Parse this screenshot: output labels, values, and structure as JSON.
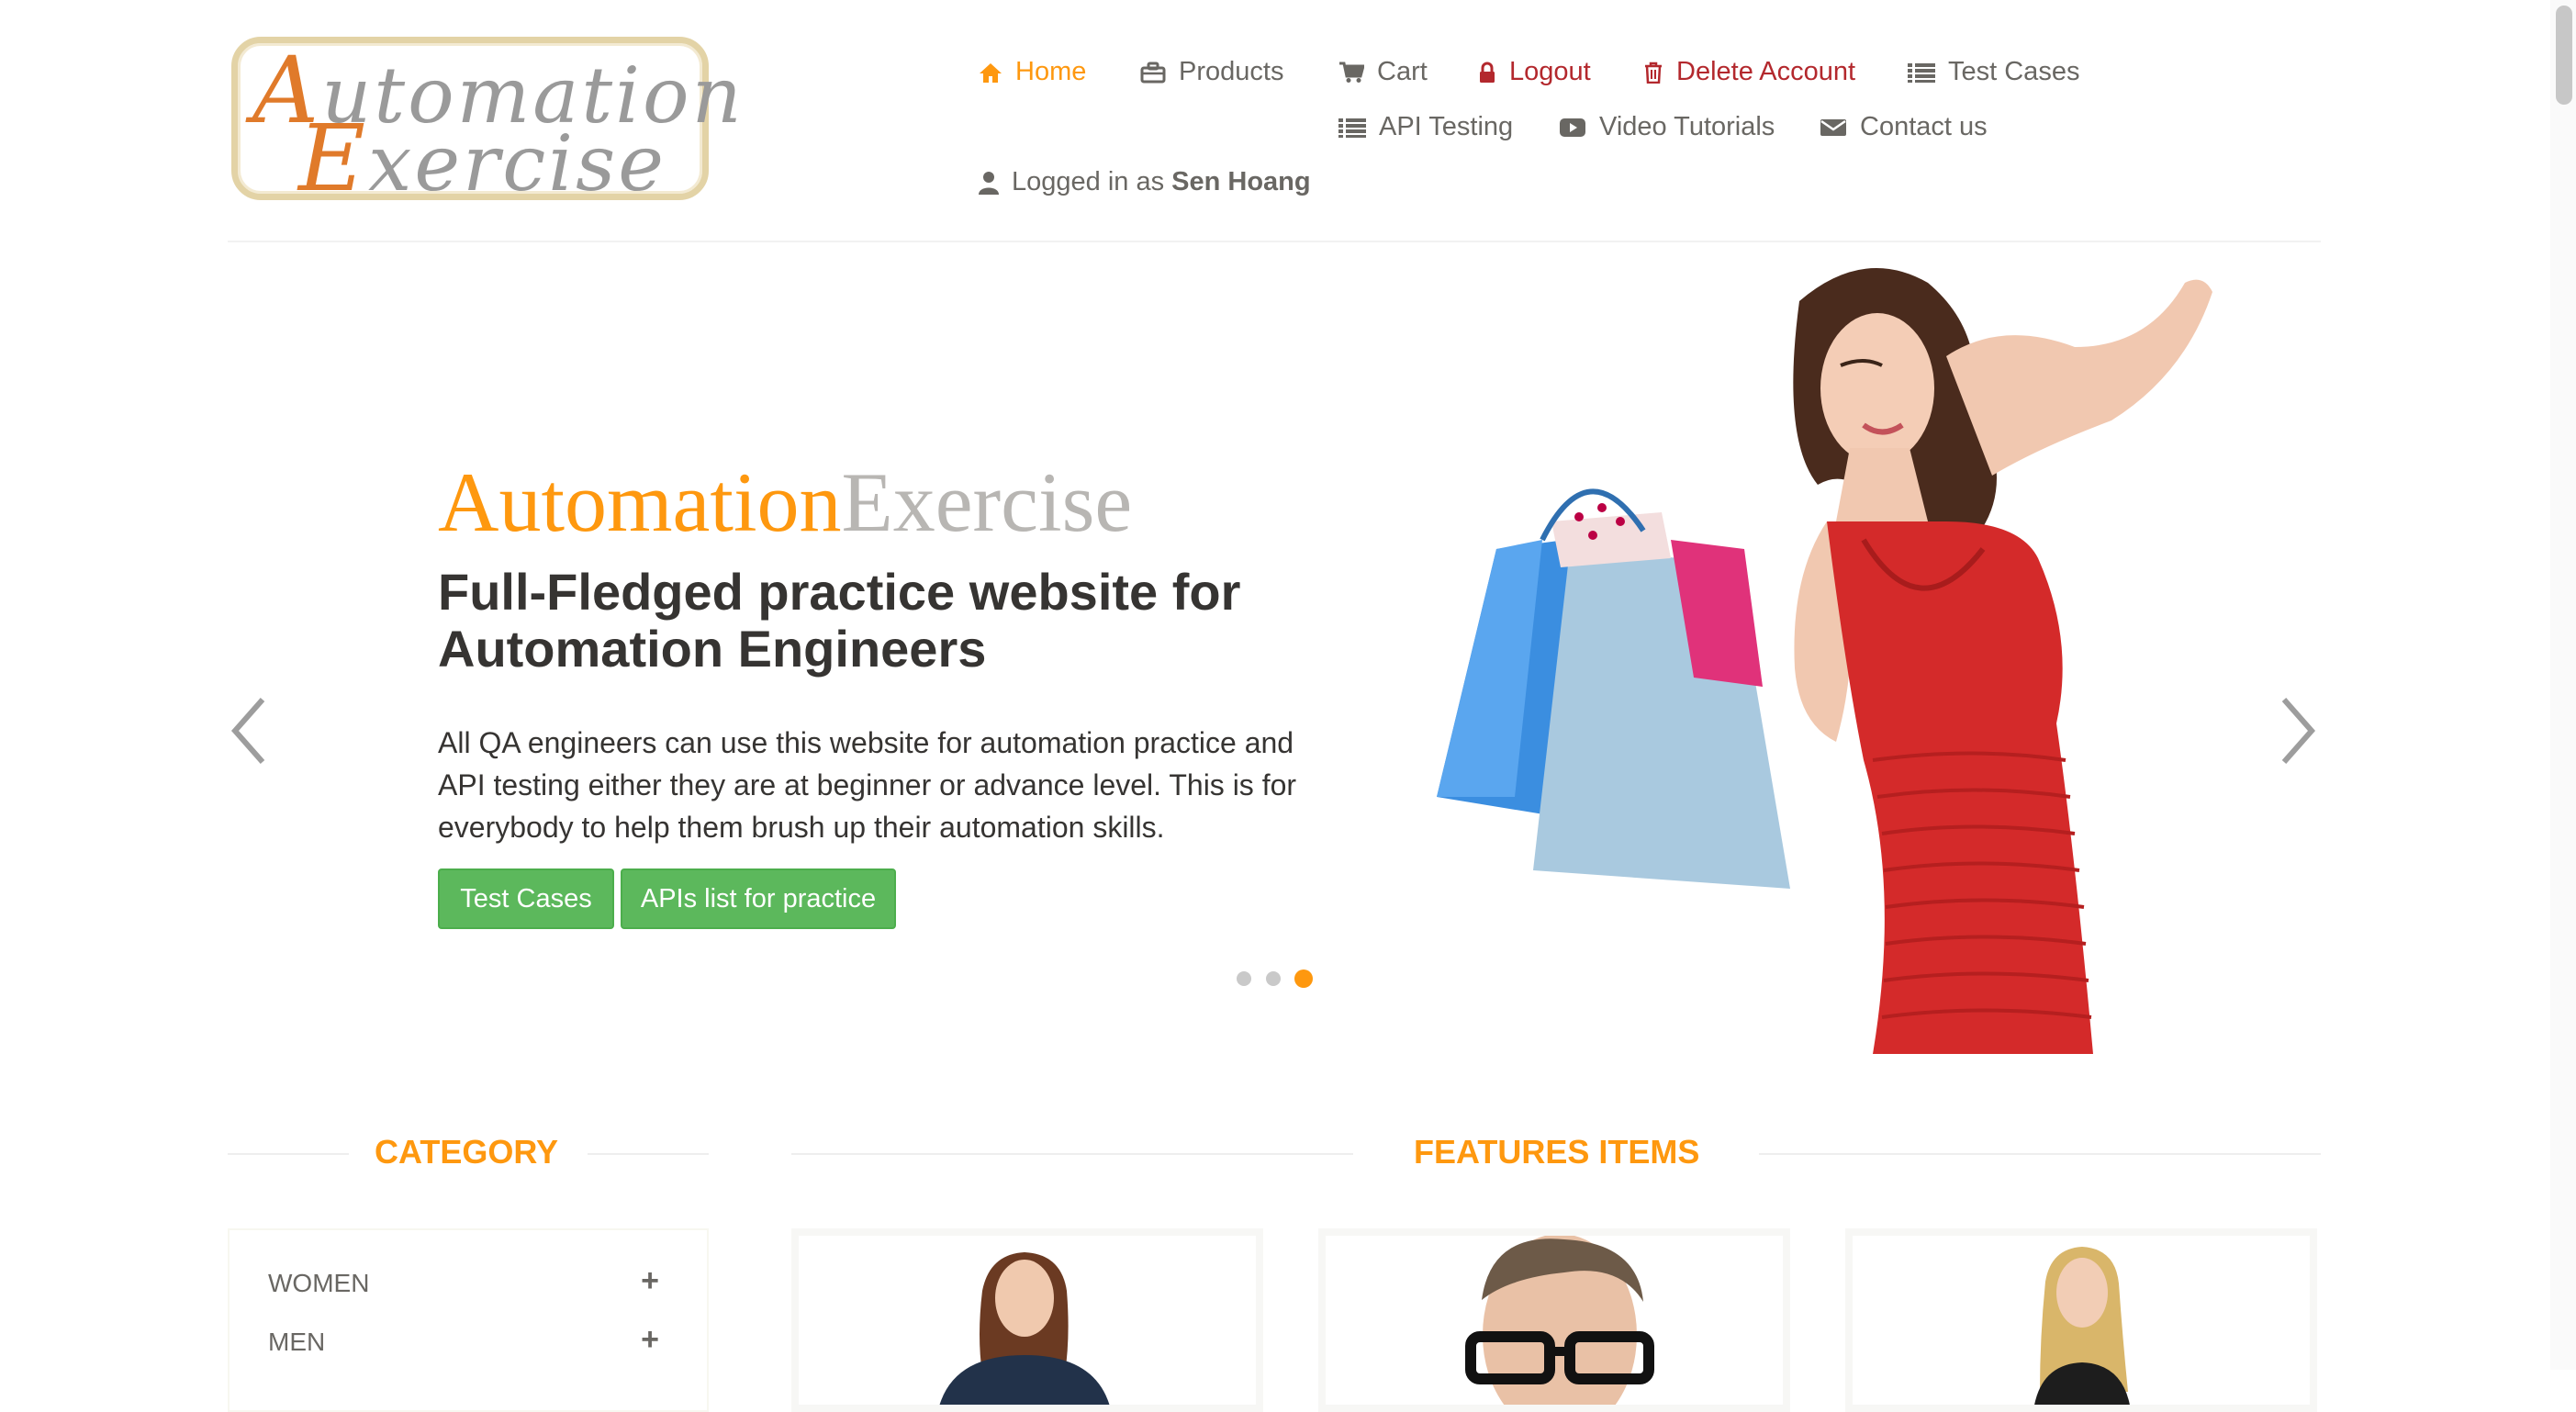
{
  "logo": {
    "line1_cap": "A",
    "line1_rest": "utomation",
    "line2_cap": "E",
    "line2_rest": "xercise"
  },
  "nav": {
    "home": "Home",
    "products": "Products",
    "cart": "Cart",
    "logout": "Logout",
    "delete_account": "Delete Account",
    "test_cases": "Test Cases",
    "api_testing": "API Testing",
    "video_tutorials": "Video Tutorials",
    "contact_us": "Contact us",
    "logged_in_prefix": "Logged in as",
    "logged_in_user": "Sen Hoang"
  },
  "hero": {
    "brand_a": "Automation",
    "brand_b": "Exercise",
    "headline": "Full-Fledged practice website for Automation Engineers",
    "description": "All QA engineers can use this website for automation practice and API testing either they are at beginner or advance level. This is for everybody to help them brush up their automation skills.",
    "btn_test_cases": "Test Cases",
    "btn_apis": "APIs list for practice",
    "active_slide": 3
  },
  "category": {
    "title": "CATEGORY",
    "items": [
      {
        "label": "WOMEN"
      },
      {
        "label": "MEN"
      }
    ]
  },
  "features": {
    "title": "FEATURES ITEMS"
  },
  "colors": {
    "accent": "#fe980f",
    "danger": "#b3282d",
    "button": "#5cb85c",
    "text": "#696763"
  },
  "icons": {
    "home": "home-icon",
    "products": "briefcase-icon",
    "cart": "cart-icon",
    "logout": "lock-icon",
    "delete": "trash-icon",
    "list": "list-icon",
    "video": "youtube-icon",
    "contact": "envelope-icon",
    "user": "user-icon"
  }
}
